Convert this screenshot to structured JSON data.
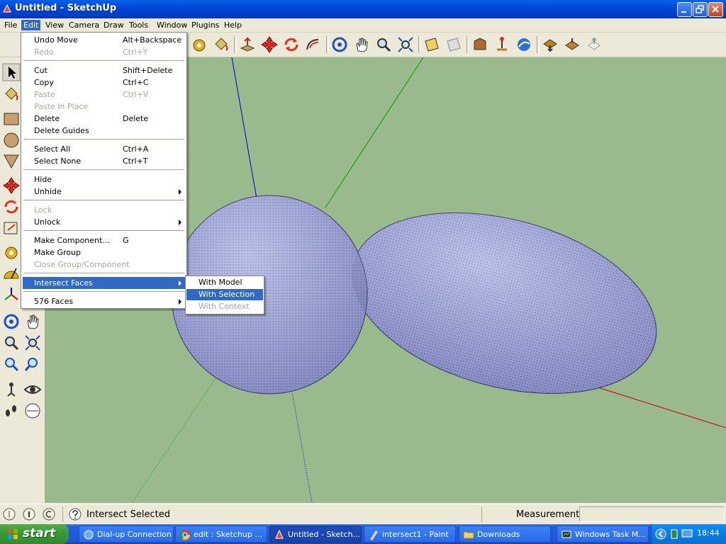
{
  "window": {
    "title": "Untitled - SketchUp",
    "minimize_icon": "minimize-icon",
    "maximize_icon": "restore-icon",
    "close_icon": "close-icon"
  },
  "menubar": {
    "items": [
      {
        "label": "File"
      },
      {
        "label": "Edit"
      },
      {
        "label": "View"
      },
      {
        "label": "Camera"
      },
      {
        "label": "Draw"
      },
      {
        "label": "Tools"
      },
      {
        "label": "Window"
      },
      {
        "label": "Plugins"
      },
      {
        "label": "Help"
      }
    ],
    "active": "Edit"
  },
  "edit_menu": {
    "items": [
      {
        "label": "Undo Move",
        "shortcut": "Alt+Backspace",
        "disabled": false
      },
      {
        "label": "Redo",
        "shortcut": "Ctrl+Y",
        "disabled": true
      },
      {
        "label": "Cut",
        "shortcut": "Shift+Delete",
        "disabled": false
      },
      {
        "label": "Copy",
        "shortcut": "Ctrl+C",
        "disabled": false
      },
      {
        "label": "Paste",
        "shortcut": "Ctrl+V",
        "disabled": true
      },
      {
        "label": "Paste In Place",
        "shortcut": "",
        "disabled": true
      },
      {
        "label": "Delete",
        "shortcut": "Delete",
        "disabled": false
      },
      {
        "label": "Delete Guides",
        "shortcut": "",
        "disabled": false
      },
      {
        "label": "Select All",
        "shortcut": "Ctrl+A",
        "disabled": false
      },
      {
        "label": "Select None",
        "shortcut": "Ctrl+T",
        "disabled": false
      },
      {
        "label": "Hide",
        "shortcut": "",
        "disabled": false
      },
      {
        "label": "Unhide",
        "shortcut": "",
        "disabled": false,
        "submenu": true
      },
      {
        "label": "Lock",
        "shortcut": "",
        "disabled": true
      },
      {
        "label": "Unlock",
        "shortcut": "",
        "disabled": false,
        "submenu": true
      },
      {
        "label": "Make Component...",
        "shortcut": "G",
        "disabled": false
      },
      {
        "label": "Make Group",
        "shortcut": "",
        "disabled": false
      },
      {
        "label": "Close Group/Component",
        "shortcut": "",
        "disabled": true
      },
      {
        "label": "Intersect Faces",
        "shortcut": "",
        "disabled": false,
        "submenu": true,
        "highlighted": true
      },
      {
        "label": "576 Faces",
        "shortcut": "",
        "disabled": false,
        "submenu": true
      }
    ]
  },
  "intersect_submenu": {
    "items": [
      {
        "label": "With Model",
        "disabled": false
      },
      {
        "label": "With Selection",
        "disabled": false,
        "highlighted": true
      },
      {
        "label": "With Context",
        "disabled": true
      }
    ]
  },
  "toolbar": {
    "icons": [
      "tape-measure-icon",
      "paint-bucket-icon",
      "push-pull-icon",
      "move-icon",
      "rotate-icon",
      "follow-me-icon",
      "orbit-icon",
      "pan-icon",
      "zoom-icon",
      "zoom-extents-icon",
      "section-plane-icon",
      "section-display-icon",
      "get-models-icon",
      "place-model-icon",
      "google-earth-icon",
      "get-current-view-icon",
      "toggle-terrain-icon",
      "share-model-icon"
    ]
  },
  "left_toolbar": {
    "icons": [
      "select-icon",
      "paint-bucket-icon",
      "rectangle-icon",
      "circle-icon",
      "polygon-icon",
      "move-icon",
      "rotate-icon",
      "scale-icon",
      "tape-measure-icon",
      "protractor-icon",
      "axes-icon",
      "orbit-icon",
      "pan-icon",
      "zoom-icon",
      "zoom-extents-icon",
      "previous-view-icon",
      "next-view-icon",
      "position-camera-icon",
      "look-around-icon",
      "walk-icon",
      "section-plane-icon"
    ]
  },
  "colors": {
    "viewport_bg": "#9ab98d",
    "sphere_fill": "#a7aee3",
    "menu_highlight": "#316ac5",
    "axis_red": "#d00000",
    "axis_green": "#00a000",
    "axis_blue": "#0000c8"
  },
  "statusbar": {
    "text": "Intersect Selected",
    "measurements_label": "Measurements",
    "measurements_value": ""
  },
  "taskbar": {
    "start_label": "start",
    "tasks": [
      {
        "label": "Dial-up Connection",
        "icon": "network-icon",
        "active": false
      },
      {
        "label": "edit : Sketchup ...",
        "icon": "chrome-icon",
        "active": false
      },
      {
        "label": "Untitled - Sketch...",
        "icon": "sketchup-icon",
        "active": true
      },
      {
        "label": "intersect1 - Paint",
        "icon": "paint-icon",
        "active": false
      },
      {
        "label": "Downloads",
        "icon": "folder-icon",
        "active": false
      },
      {
        "label": "Windows Task M...",
        "icon": "task-manager-icon",
        "active": false
      }
    ],
    "clock": "18:44"
  }
}
